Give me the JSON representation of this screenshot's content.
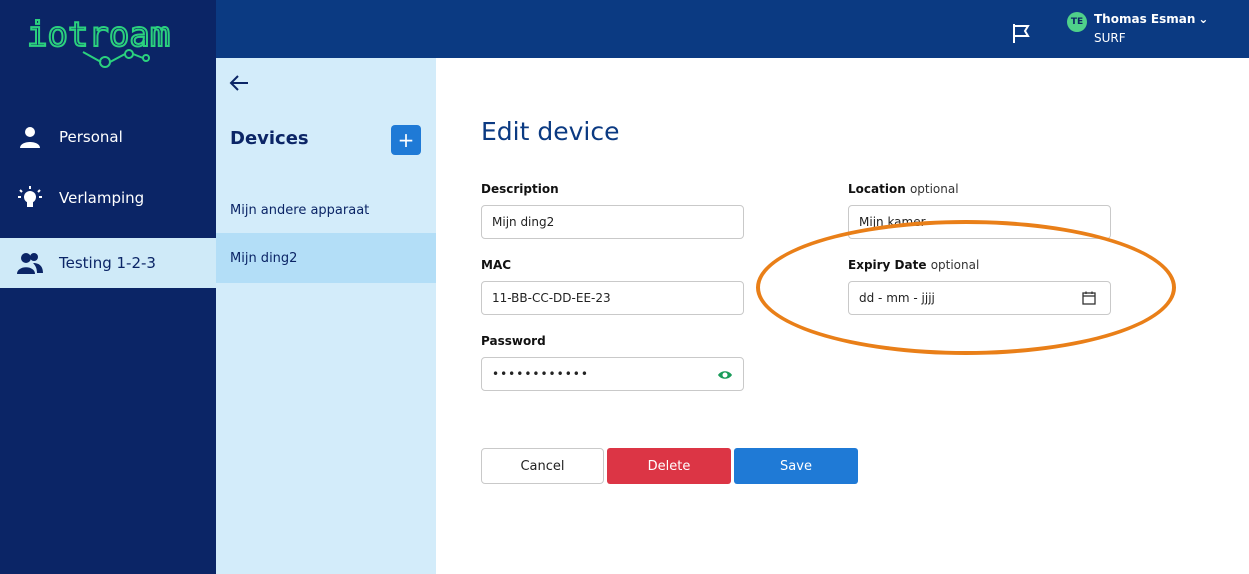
{
  "brand": {
    "logo_text": "iotroam",
    "logo_color": "#2bd17e"
  },
  "colors": {
    "sidebar": "#0b2566",
    "topbar": "#0b3a82",
    "accent": "#1f7ad6",
    "danger": "#dc3545",
    "highlight": "#e97f18"
  },
  "user": {
    "initials": "TE",
    "name": "Thomas Esman",
    "org": "SURF"
  },
  "sidebar": {
    "items": [
      {
        "label": "Personal",
        "icon": "person-icon"
      },
      {
        "label": "Verlamping",
        "icon": "lightbulb-icon"
      },
      {
        "label": "Testing 1-2-3",
        "icon": "group-icon",
        "active": true
      }
    ]
  },
  "devices": {
    "title": "Devices",
    "add_label": "+",
    "items": [
      {
        "label": "Mijn andere apparaat"
      },
      {
        "label": "Mijn ding2",
        "active": true
      }
    ]
  },
  "form": {
    "title": "Edit device",
    "description": {
      "label": "Description",
      "value": "Mijn ding2"
    },
    "location": {
      "label": "Location",
      "optional": "optional",
      "value": "Mijn kamer"
    },
    "mac": {
      "label": "MAC",
      "value": "11-BB-CC-DD-EE-23"
    },
    "expiry": {
      "label": "Expiry Date",
      "optional": "optional",
      "placeholder": "dd - mm - jjjj"
    },
    "password": {
      "label": "Password",
      "value": "••••••••••••"
    }
  },
  "buttons": {
    "cancel": "Cancel",
    "delete": "Delete",
    "save": "Save"
  }
}
